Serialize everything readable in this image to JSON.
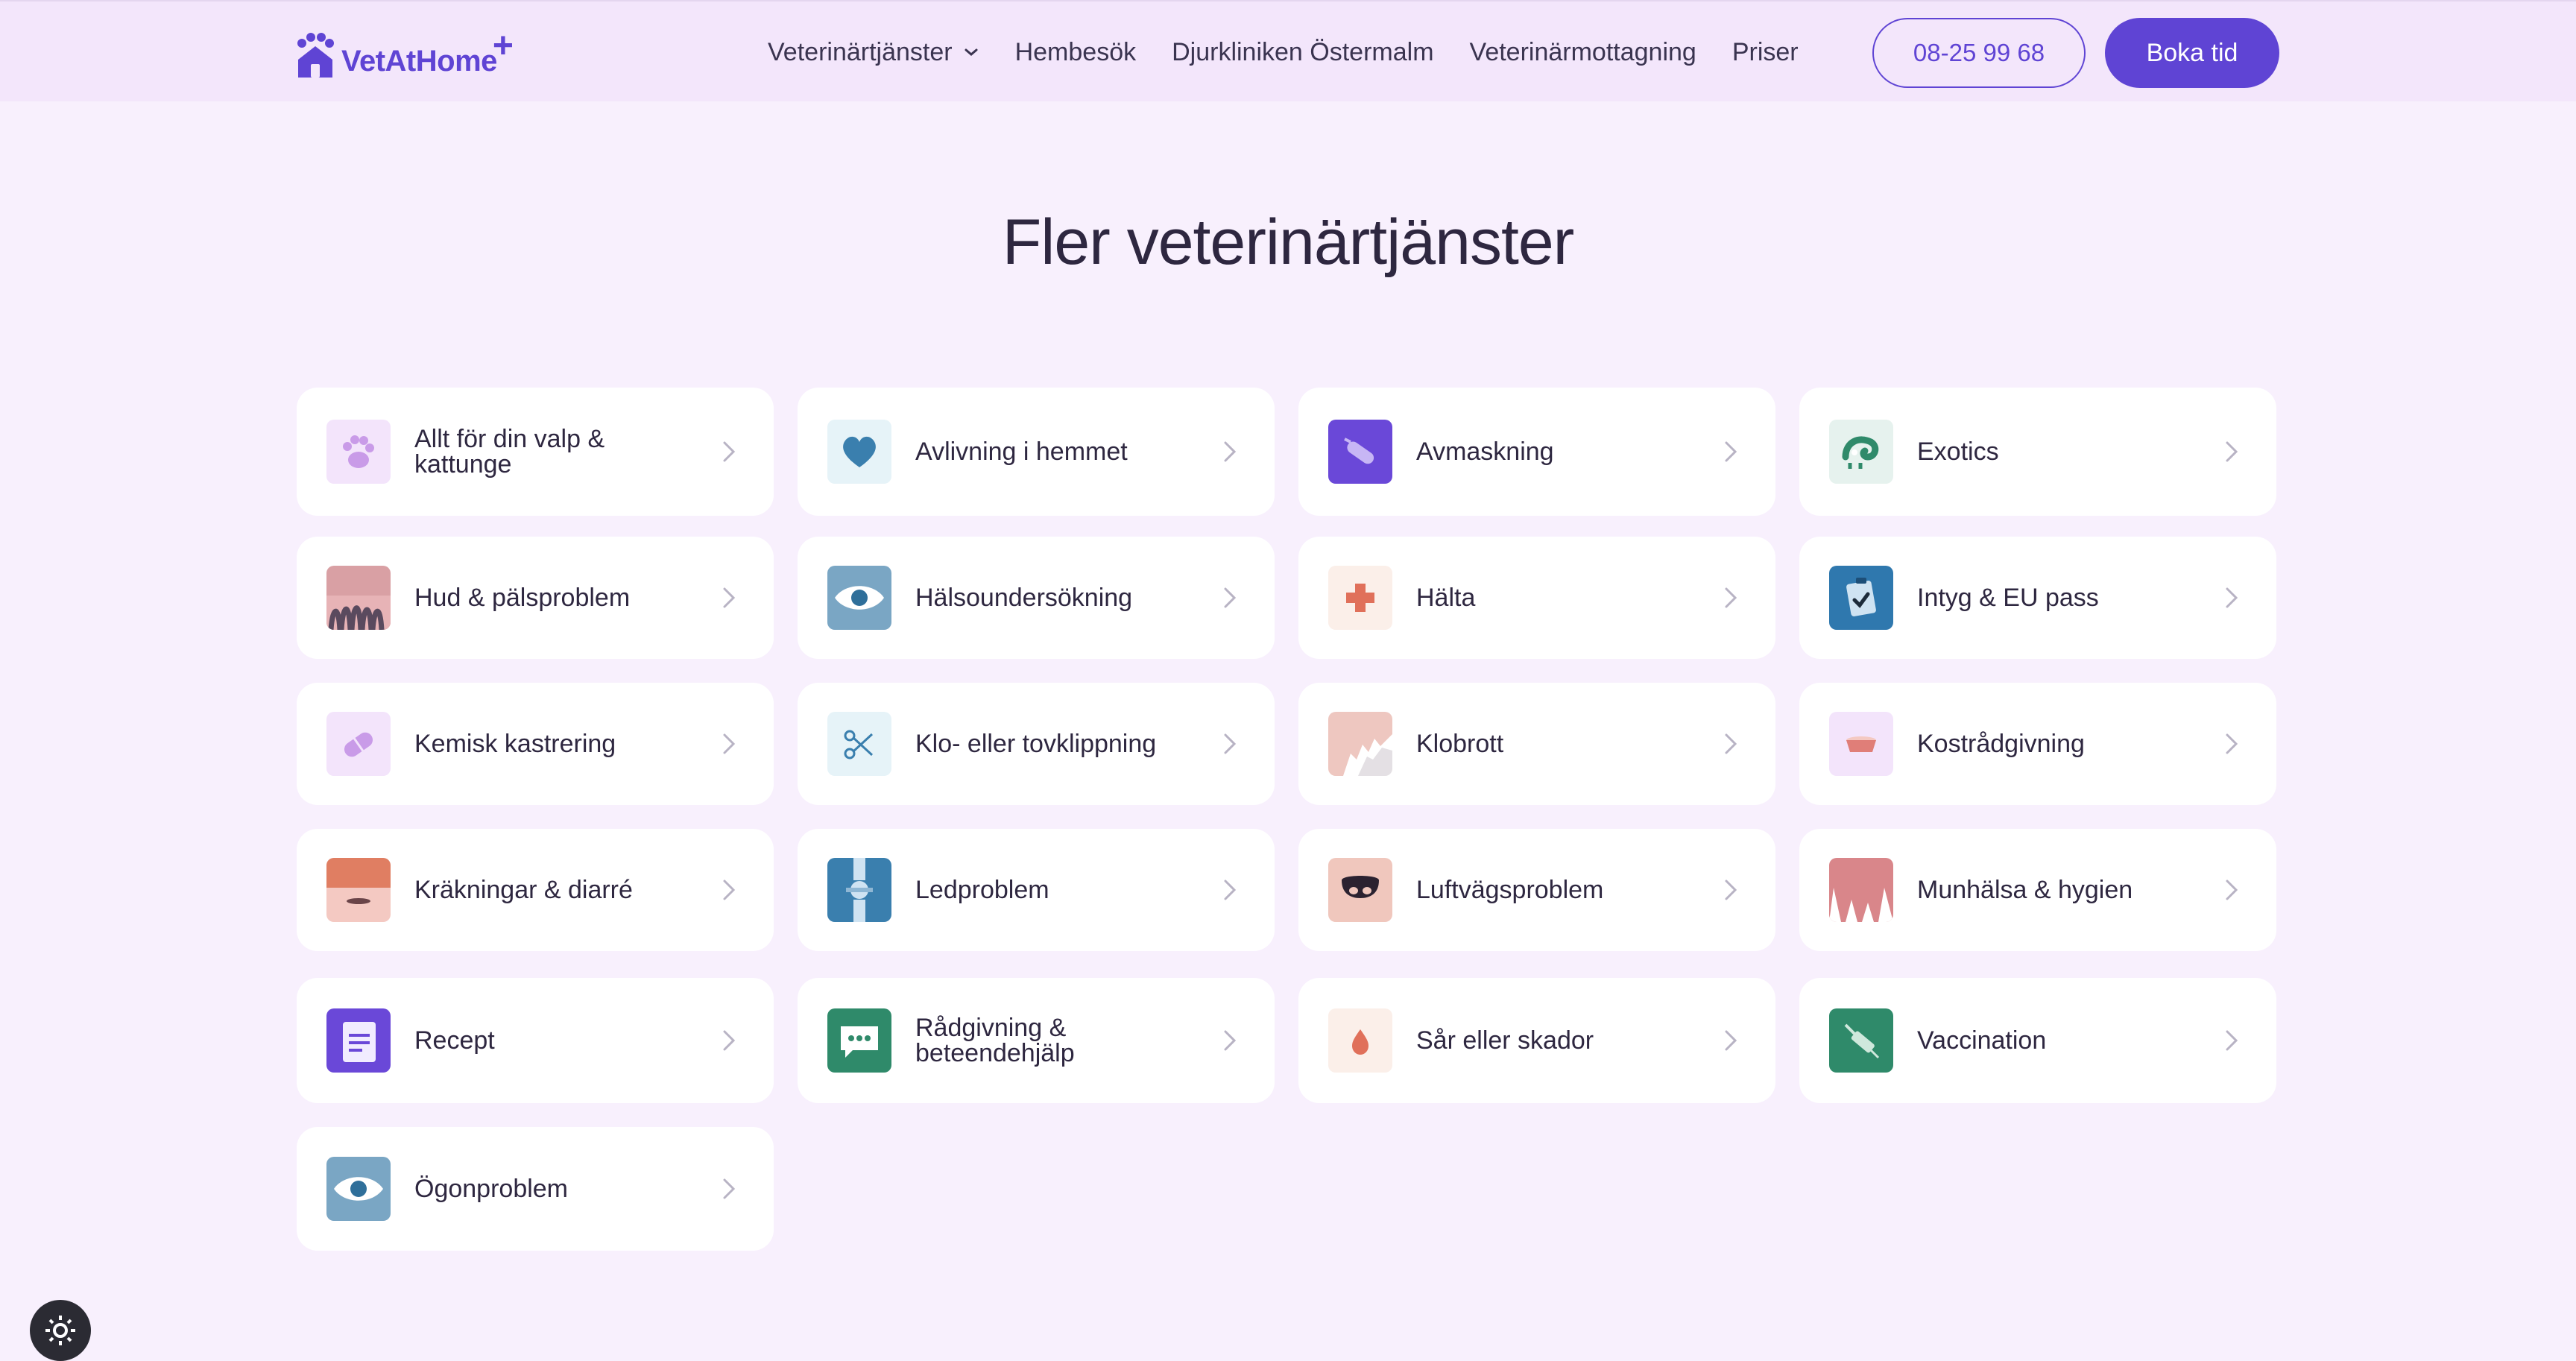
{
  "header": {
    "logo_text": "VetAtHome",
    "logo_plus": "+",
    "nav": [
      {
        "label": "Veterinärtjänster",
        "dropdown": true
      },
      {
        "label": "Hembesök"
      },
      {
        "label": "Djurkliniken Östermalm"
      },
      {
        "label": "Veterinärmottagning"
      },
      {
        "label": "Priser"
      }
    ],
    "phone": "08-25 99 68",
    "book": "Boka tid"
  },
  "page": {
    "title": "Fler veterinärtjänster"
  },
  "services": [
    {
      "label": "Allt för din valp & kattunge",
      "icon": "paw-icon"
    },
    {
      "label": "Avlivning i hemmet",
      "icon": "heart-icon"
    },
    {
      "label": "Avmaskning",
      "icon": "pill-syringe-icon"
    },
    {
      "label": "Exotics",
      "icon": "chameleon-icon"
    },
    {
      "label": "Hud & pälsproblem",
      "icon": "fur-icon"
    },
    {
      "label": "Hälsoundersökning",
      "icon": "eye-icon"
    },
    {
      "label": "Hälta",
      "icon": "cross-icon"
    },
    {
      "label": "Intyg & EU pass",
      "icon": "clipboard-check-icon"
    },
    {
      "label": "Kemisk kastrering",
      "icon": "capsule-icon"
    },
    {
      "label": "Klo- eller tovklippning",
      "icon": "scissors-icon"
    },
    {
      "label": "Klobrott",
      "icon": "claw-icon"
    },
    {
      "label": "Kostrådgivning",
      "icon": "food-bowl-icon"
    },
    {
      "label": "Kräkningar & diarré",
      "icon": "stomach-icon"
    },
    {
      "label": "Ledproblem",
      "icon": "bone-joint-icon"
    },
    {
      "label": "Luftvägsproblem",
      "icon": "nose-icon"
    },
    {
      "label": "Munhälsa & hygien",
      "icon": "teeth-icon"
    },
    {
      "label": "Recept",
      "icon": "document-icon"
    },
    {
      "label": "Rådgivning & beteendehjälp",
      "icon": "chat-bubble-icon"
    },
    {
      "label": "Sår eller skador",
      "icon": "blood-drop-icon"
    },
    {
      "label": "Vaccination",
      "icon": "vaccine-icon"
    },
    {
      "label": "Ögonproblem",
      "icon": "eye-icon"
    }
  ],
  "colors": {
    "brand": "#5f44d4",
    "header_bg": "#f3e6fb",
    "page_bg": "#f8f0fd",
    "card_bg": "#ffffff",
    "text": "#2e2740"
  }
}
